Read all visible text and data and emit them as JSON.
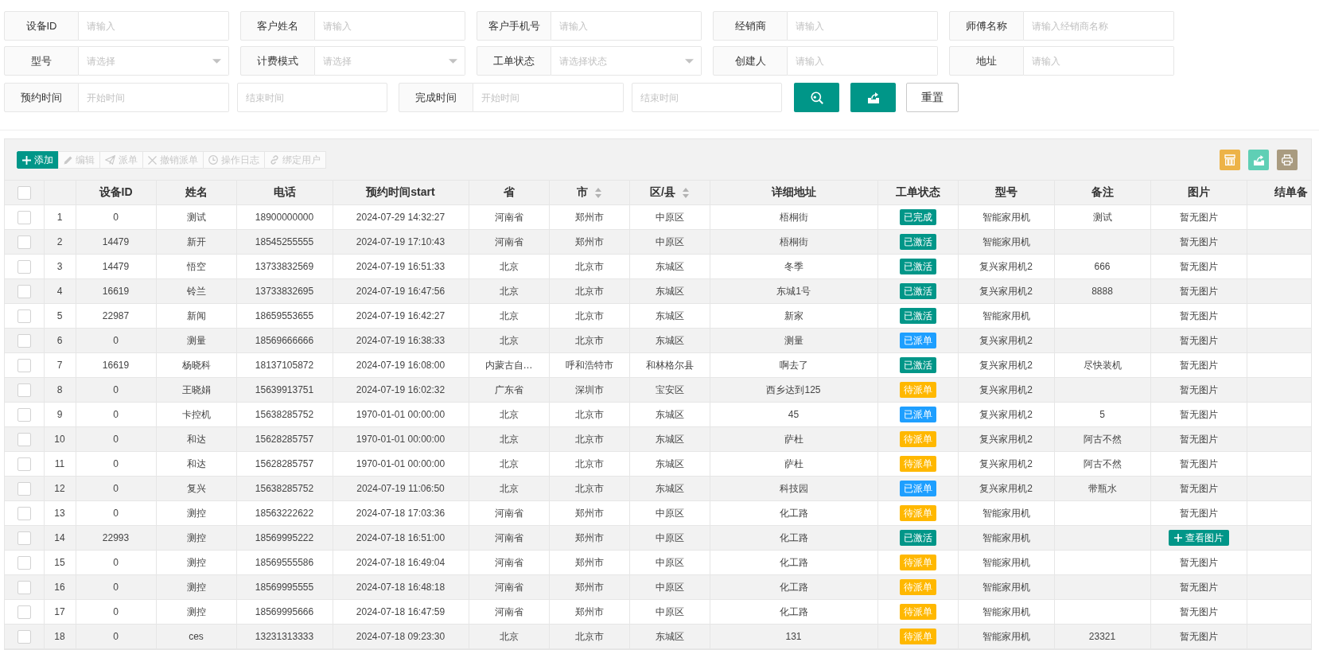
{
  "filters": [
    [
      {
        "kind": "text",
        "label": "设备ID",
        "placeholder": "请输入"
      },
      {
        "kind": "text",
        "label": "客户姓名",
        "placeholder": "请输入"
      },
      {
        "kind": "text",
        "label": "客户手机号",
        "placeholder": "请输入"
      },
      {
        "kind": "text",
        "label": "经销商",
        "placeholder": "请输入"
      },
      {
        "kind": "text",
        "label": "师傅名称",
        "placeholder": "请输入经销商名称"
      }
    ],
    [
      {
        "kind": "select",
        "label": "型号",
        "placeholder": "请选择"
      },
      {
        "kind": "select",
        "label": "计费模式",
        "placeholder": "请选择"
      },
      {
        "kind": "select",
        "label": "工单状态",
        "placeholder": "请选择状态"
      },
      {
        "kind": "text",
        "label": "创建人",
        "placeholder": "请输入"
      },
      {
        "kind": "text",
        "label": "地址",
        "placeholder": "请输入"
      }
    ]
  ],
  "date_filters": [
    {
      "label": "预约时间",
      "start_placeholder": "开始时间",
      "end_placeholder": "结束时间"
    },
    {
      "label": "完成时间",
      "start_placeholder": "开始时间",
      "end_placeholder": "结束时间"
    }
  ],
  "reset_button": "重置",
  "toolbar": [
    {
      "label": "添加",
      "disabled": false
    },
    {
      "label": "编辑",
      "disabled": true
    },
    {
      "label": "派单",
      "disabled": true
    },
    {
      "label": "撤销派单",
      "disabled": true
    },
    {
      "label": "操作日志",
      "disabled": true
    },
    {
      "label": "绑定用户",
      "disabled": true
    }
  ],
  "table": {
    "select_all": false,
    "columns": [
      {
        "label": "设备ID",
        "sortable": false
      },
      {
        "label": "姓名",
        "sortable": false
      },
      {
        "label": "电话",
        "sortable": false
      },
      {
        "label": "预约时间start",
        "sortable": false
      },
      {
        "label": "省",
        "sortable": false
      },
      {
        "label": "市",
        "sortable": true
      },
      {
        "label": "区/县",
        "sortable": true
      },
      {
        "label": "详细地址",
        "sortable": false
      },
      {
        "label": "工单状态",
        "sortable": false
      },
      {
        "label": "型号",
        "sortable": false
      },
      {
        "label": "备注",
        "sortable": false
      },
      {
        "label": "图片",
        "sortable": false
      },
      {
        "label": "结单备",
        "sortable": false
      }
    ],
    "rows": [
      {
        "selected": false,
        "index": "1",
        "device_id": "0",
        "name": "测试",
        "phone": "18900000000",
        "appointment_time": "2024-07-29 14:32:27",
        "province": "河南省",
        "city": "郑州市",
        "district": "中原区",
        "address": "梧桐街",
        "status": {
          "text": "已完成",
          "color": "#009688"
        },
        "model": "智能家用机",
        "remark": "测试",
        "image": {
          "kind": "text",
          "text": "暂无图片"
        }
      },
      {
        "selected": false,
        "index": "2",
        "device_id": "14479",
        "name": "新开",
        "phone": "18545255555",
        "appointment_time": "2024-07-19 17:10:43",
        "province": "河南省",
        "city": "郑州市",
        "district": "中原区",
        "address": "梧桐街",
        "status": {
          "text": "已激活",
          "color": "#009688"
        },
        "model": "智能家用机",
        "image": {
          "kind": "text",
          "text": "暂无图片"
        }
      },
      {
        "selected": false,
        "index": "3",
        "device_id": "14479",
        "name": "悟空",
        "phone": "13733832569",
        "appointment_time": "2024-07-19 16:51:33",
        "province": "北京",
        "city": "北京市",
        "district": "东城区",
        "address": "冬季",
        "status": {
          "text": "已激活",
          "color": "#009688"
        },
        "model": "复兴家用机2",
        "remark": "666",
        "image": {
          "kind": "text",
          "text": "暂无图片"
        }
      },
      {
        "selected": false,
        "index": "4",
        "device_id": "16619",
        "name": "铃兰",
        "phone": "13733832695",
        "appointment_time": "2024-07-19 16:47:56",
        "province": "北京",
        "city": "北京市",
        "district": "东城区",
        "address": "东城1号",
        "status": {
          "text": "已激活",
          "color": "#009688"
        },
        "model": "复兴家用机2",
        "remark": "8888",
        "image": {
          "kind": "text",
          "text": "暂无图片"
        }
      },
      {
        "selected": false,
        "index": "5",
        "device_id": "22987",
        "name": "新闻",
        "phone": "18659553655",
        "appointment_time": "2024-07-19 16:42:27",
        "province": "北京",
        "city": "北京市",
        "district": "东城区",
        "address": "新家",
        "status": {
          "text": "已激活",
          "color": "#009688"
        },
        "model": "智能家用机",
        "image": {
          "kind": "text",
          "text": "暂无图片"
        }
      },
      {
        "selected": false,
        "index": "6",
        "device_id": "0",
        "name": "测量",
        "phone": "18569666666",
        "appointment_time": "2024-07-19 16:38:33",
        "province": "北京",
        "city": "北京市",
        "district": "东城区",
        "address": "测量",
        "status": {
          "text": "已派单",
          "color": "#1e9fff"
        },
        "model": "复兴家用机2",
        "image": {
          "kind": "text",
          "text": "暂无图片"
        }
      },
      {
        "selected": false,
        "index": "7",
        "device_id": "16619",
        "name": "杨晓科",
        "phone": "18137105872",
        "appointment_time": "2024-07-19 16:08:00",
        "province": "内蒙古自…",
        "city": "呼和浩特市",
        "district": "和林格尔县",
        "address": "啊去了",
        "status": {
          "text": "已激活",
          "color": "#009688"
        },
        "model": "复兴家用机2",
        "remark": "尽快装机",
        "image": {
          "kind": "text",
          "text": "暂无图片"
        }
      },
      {
        "selected": false,
        "index": "8",
        "device_id": "0",
        "name": "王晓娟",
        "phone": "15639913751",
        "appointment_time": "2024-07-19 16:02:32",
        "province": "广东省",
        "city": "深圳市",
        "district": "宝安区",
        "address": "西乡达到125",
        "status": {
          "text": "待派单",
          "color": "#ffb800"
        },
        "model": "复兴家用机2",
        "image": {
          "kind": "text",
          "text": "暂无图片"
        }
      },
      {
        "selected": false,
        "index": "9",
        "device_id": "0",
        "name": "卡控机",
        "phone": "15638285752",
        "appointment_time": "1970-01-01 00:00:00",
        "province": "北京",
        "city": "北京市",
        "district": "东城区",
        "address": "45",
        "status": {
          "text": "已派单",
          "color": "#1e9fff"
        },
        "model": "复兴家用机2",
        "remark": "5",
        "image": {
          "kind": "text",
          "text": "暂无图片"
        }
      },
      {
        "selected": false,
        "index": "10",
        "device_id": "0",
        "name": "和达",
        "phone": "15628285757",
        "appointment_time": "1970-01-01 00:00:00",
        "province": "北京",
        "city": "北京市",
        "district": "东城区",
        "address": "萨杜",
        "status": {
          "text": "待派单",
          "color": "#ffb800"
        },
        "model": "复兴家用机2",
        "remark": "阿古不然",
        "image": {
          "kind": "text",
          "text": "暂无图片"
        }
      },
      {
        "selected": false,
        "index": "11",
        "device_id": "0",
        "name": "和达",
        "phone": "15628285757",
        "appointment_time": "1970-01-01 00:00:00",
        "province": "北京",
        "city": "北京市",
        "district": "东城区",
        "address": "萨杜",
        "status": {
          "text": "待派单",
          "color": "#ffb800"
        },
        "model": "复兴家用机2",
        "remark": "阿古不然",
        "image": {
          "kind": "text",
          "text": "暂无图片"
        }
      },
      {
        "selected": false,
        "index": "12",
        "device_id": "0",
        "name": "复兴",
        "phone": "15638285752",
        "appointment_time": "2024-07-19 11:06:50",
        "province": "北京",
        "city": "北京市",
        "district": "东城区",
        "address": "科技园",
        "status": {
          "text": "已派单",
          "color": "#1e9fff"
        },
        "model": "复兴家用机2",
        "remark": "带瓶水",
        "image": {
          "kind": "text",
          "text": "暂无图片"
        }
      },
      {
        "selected": false,
        "index": "13",
        "device_id": "0",
        "name": "测控",
        "phone": "18563222622",
        "appointment_time": "2024-07-18 17:03:36",
        "province": "河南省",
        "city": "郑州市",
        "district": "中原区",
        "address": "化工路",
        "status": {
          "text": "待派单",
          "color": "#ffb800"
        },
        "model": "智能家用机",
        "image": {
          "kind": "text",
          "text": "暂无图片"
        }
      },
      {
        "selected": false,
        "index": "14",
        "device_id": "22993",
        "name": "测控",
        "phone": "18569995222",
        "appointment_time": "2024-07-18 16:51:00",
        "province": "河南省",
        "city": "郑州市",
        "district": "中原区",
        "address": "化工路",
        "status": {
          "text": "已激活",
          "color": "#009688"
        },
        "model": "智能家用机",
        "image": {
          "kind": "button",
          "text": "查看图片"
        }
      },
      {
        "selected": false,
        "index": "15",
        "device_id": "0",
        "name": "测控",
        "phone": "18569555586",
        "appointment_time": "2024-07-18 16:49:04",
        "province": "河南省",
        "city": "郑州市",
        "district": "中原区",
        "address": "化工路",
        "status": {
          "text": "待派单",
          "color": "#ffb800"
        },
        "model": "智能家用机",
        "image": {
          "kind": "text",
          "text": "暂无图片"
        }
      },
      {
        "selected": false,
        "index": "16",
        "device_id": "0",
        "name": "测控",
        "phone": "18569995555",
        "appointment_time": "2024-07-18 16:48:18",
        "province": "河南省",
        "city": "郑州市",
        "district": "中原区",
        "address": "化工路",
        "status": {
          "text": "待派单",
          "color": "#ffb800"
        },
        "model": "智能家用机",
        "image": {
          "kind": "text",
          "text": "暂无图片"
        }
      },
      {
        "selected": false,
        "index": "17",
        "device_id": "0",
        "name": "测控",
        "phone": "18569995666",
        "appointment_time": "2024-07-18 16:47:59",
        "province": "河南省",
        "city": "郑州市",
        "district": "中原区",
        "address": "化工路",
        "status": {
          "text": "待派单",
          "color": "#ffb800"
        },
        "model": "智能家用机",
        "image": {
          "kind": "text",
          "text": "暂无图片"
        }
      },
      {
        "selected": false,
        "index": "18",
        "device_id": "0",
        "name": "ces",
        "phone": "13231313333",
        "appointment_time": "2024-07-18 09:23:30",
        "province": "北京",
        "city": "北京市",
        "district": "东城区",
        "address": "131",
        "status": {
          "text": "待派单",
          "color": "#ffb800"
        },
        "model": "智能家用机",
        "remark": "23321",
        "image": {
          "kind": "text",
          "text": "暂无图片"
        }
      }
    ]
  }
}
